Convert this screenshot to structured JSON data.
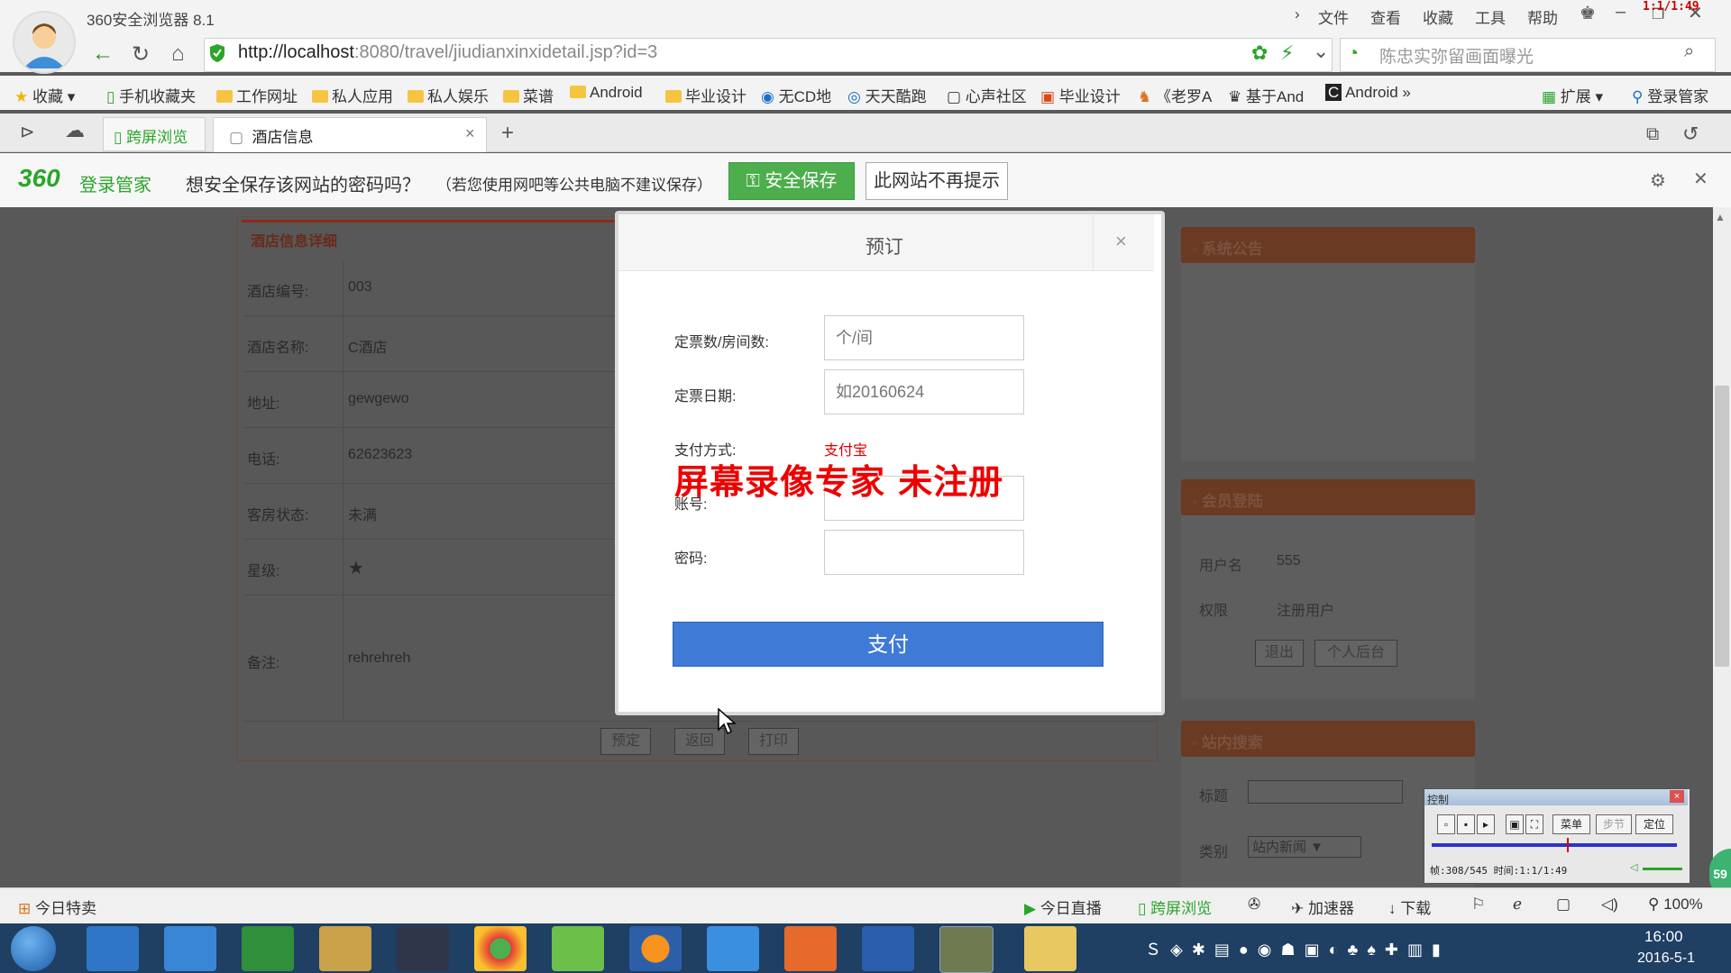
{
  "browser": {
    "title": "360安全浏览器 8.1",
    "menu": [
      "文件",
      "查看",
      "收藏",
      "工具",
      "帮助"
    ],
    "rec_time": "1:1/1:49",
    "url_host": "http://localhost",
    "url_path": ":8080/travel/jiudianxinxidetail.jsp?id=3",
    "search_text": "陈忠实弥留画面曝光"
  },
  "bookmarks": [
    "收藏",
    "手机收藏夹",
    "工作网址",
    "私人应用",
    "私人娱乐",
    "菜谱",
    "Android",
    "毕业设计",
    "无CD地",
    "天天酷跑",
    "心声社区",
    "毕业设计",
    "《老罗A",
    "基于And",
    "Android",
    "扩展",
    "登录管家"
  ],
  "tabs": {
    "sync": "跨屏浏览",
    "active": "酒店信息",
    "close": "×",
    "add": "+"
  },
  "pwbar": {
    "brand": "360",
    "brand_sub": "登录管家",
    "question": "想安全保存该网站的密码吗？",
    "hint": "（若您使用网吧等公共电脑不建议保存）",
    "save": "安全保存",
    "never": "此网站不再提示"
  },
  "hotel": {
    "header": "酒店信息详细",
    "rows": [
      {
        "label": "酒店编号:",
        "value": "003"
      },
      {
        "label": "酒店名称:",
        "value": "C酒店"
      },
      {
        "label": "地址:",
        "value": "gewgewo"
      },
      {
        "label": "电话:",
        "value": "62623623"
      },
      {
        "label": "客房状态:",
        "value": "未满"
      },
      {
        "label": "星级:",
        "value": "★"
      },
      {
        "label": "备注:",
        "value": "rehrehreh"
      }
    ],
    "buttons": [
      "预定",
      "返回",
      "打印"
    ]
  },
  "sidebar": {
    "notice": "系统公告",
    "member": "会员登陆",
    "username_label": "用户名",
    "username": "555",
    "role_label": "权限",
    "role": "注册用户",
    "logout": "退出",
    "backend": "个人后台",
    "search": "站内搜索",
    "title_label": "标题",
    "category_label": "类别",
    "category_value": "站内新闻"
  },
  "modal": {
    "title": "预订",
    "close": "×",
    "qty_label": "定票数/房间数:",
    "qty_placeholder": "个/间",
    "date_label": "定票日期:",
    "date_placeholder": "如20160624",
    "pay_label": "支付方式:",
    "pay_value": "支付宝",
    "account_label": "账号:",
    "password_label": "密码:",
    "submit": "支付",
    "watermark": "屏幕录像专家  未注册"
  },
  "ctrl": {
    "title": "控制",
    "menu": "菜单",
    "locate": "定位",
    "status": "帧:308/545 时间:1:1/1:49",
    "badge": "59"
  },
  "statusbar": {
    "left": "今日特卖",
    "live": "今日直播",
    "sync": "跨屏浏览",
    "accel": "加速器",
    "download": "下载",
    "zoom": "100%"
  },
  "taskbar": {
    "time": "16:00",
    "date": "2016-5-1"
  },
  "colors": {
    "accent": "#3e7ad6",
    "save_green": "#4cae4c",
    "brand_green": "#2aa52a"
  }
}
